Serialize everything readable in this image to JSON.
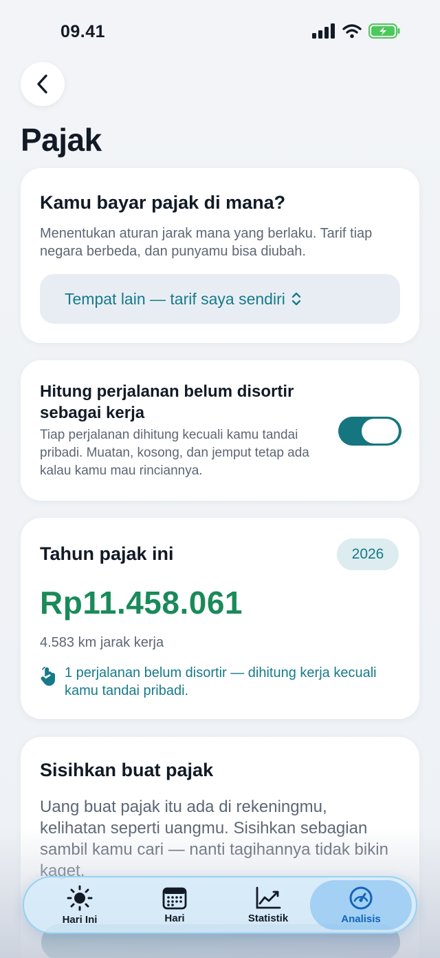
{
  "status_bar": {
    "time": "09.41"
  },
  "header": {
    "title": "Pajak"
  },
  "region_card": {
    "title": "Kamu bayar pajak di mana?",
    "description": "Menentukan aturan jarak mana yang berlaku. Tarif tiap negara berbeda, dan punyamu bisa diubah.",
    "selected_value": "Tempat lain — tarif saya sendiri"
  },
  "unsorted_card": {
    "title": "Hitung perjalanan belum disortir sebagai kerja",
    "description": "Tiap perjalanan dihitung kecuali kamu tandai pribadi. Muatan, kosong, dan jemput tetap ada kalau kamu mau rinciannya.",
    "toggle_on": true
  },
  "tax_year_card": {
    "title": "Tahun pajak ini",
    "year": "2026",
    "amount": "Rp11.458.061",
    "distance": "4.583 km jarak kerja",
    "note": "1 perjalanan belum disortir — dihitung kerja kecuali kamu tandai pribadi."
  },
  "set_aside_card": {
    "title": "Sisihkan buat pajak",
    "description": "Uang buat pajak itu ada di rekeningmu, kelihatan seperti uangmu. Sisihkan sebagian sambil kamu cari — nanti tagihannya tidak bikin kaget."
  },
  "tab_bar": {
    "tabs": [
      {
        "label": "Hari Ini",
        "icon": "sun-icon"
      },
      {
        "label": "Hari",
        "icon": "calendar-icon"
      },
      {
        "label": "Statistik",
        "icon": "chart-icon"
      },
      {
        "label": "Analisis",
        "icon": "gauge-icon"
      }
    ],
    "active": "Analisis"
  },
  "colors": {
    "accent": "#167a8a",
    "amount": "#1a8a5a",
    "toggle": "#15767f",
    "tab_active": "#1264b8"
  }
}
